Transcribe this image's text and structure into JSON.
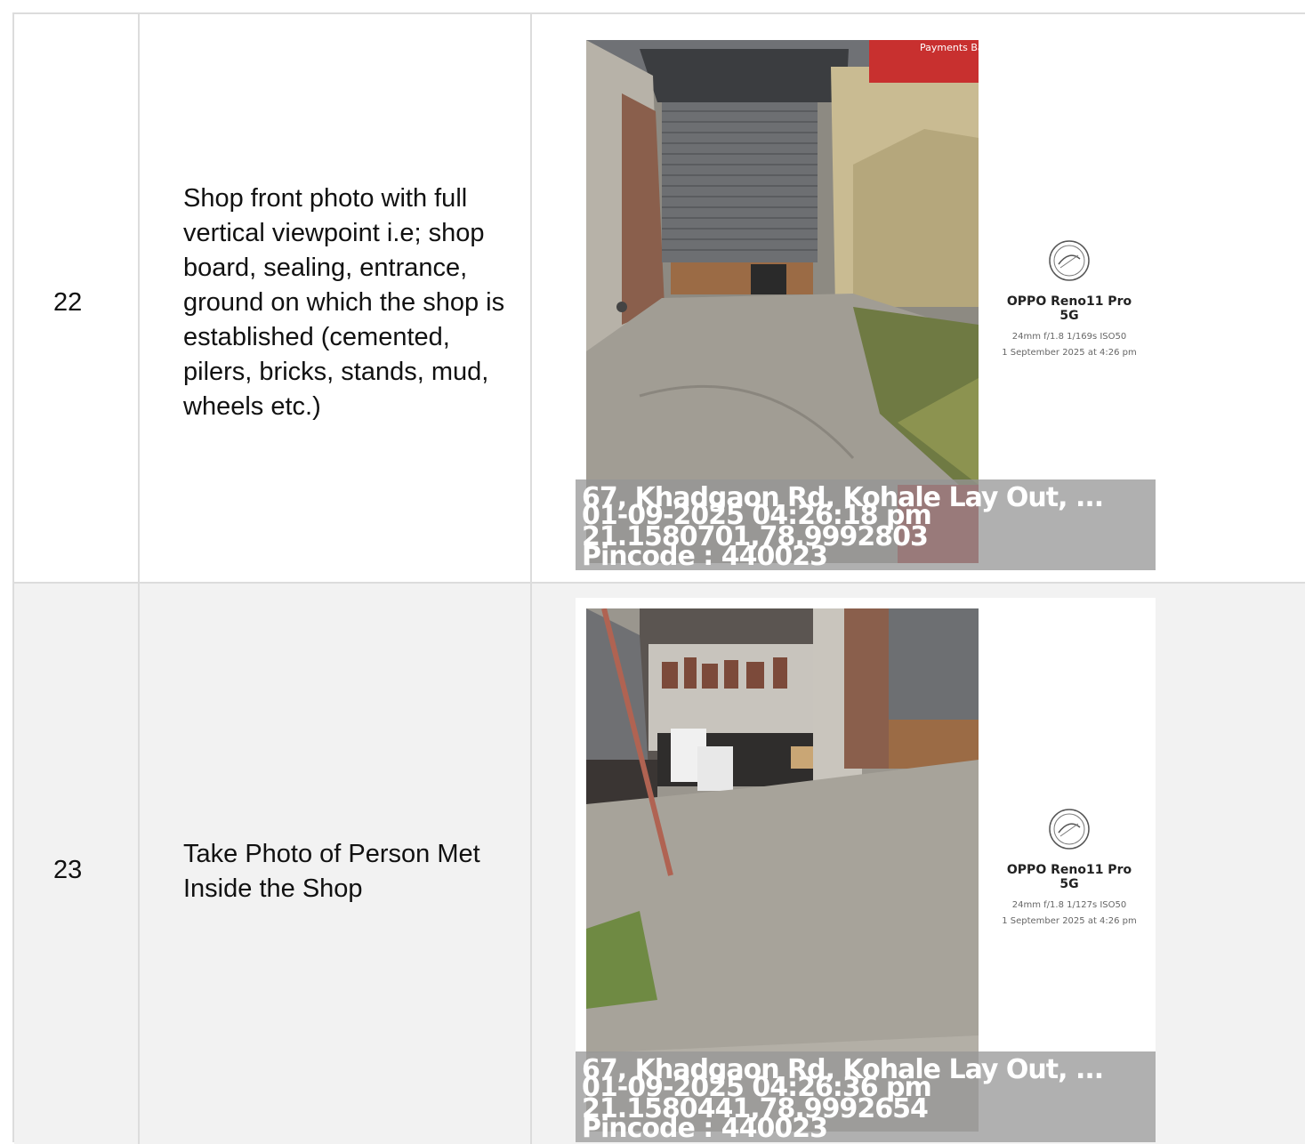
{
  "rows": [
    {
      "number": "22",
      "description": "Shop front photo with full vertical viewpoint i.e; shop board, sealing, entrance, ground on which the shop is established (cemented, pilers, bricks, stands, mud, wheels etc.)",
      "photo": {
        "camera_model": "OPPO Reno11 Pro 5G",
        "specs": "24mm  f/1.8  1/169s  ISO50",
        "captured": "1 September 2025 at 4:26 pm",
        "sign_text": "Payments Bank",
        "stamp": {
          "address": "67, Khadgaon Rd, Kohale Lay Out, ...",
          "datetime": "01-09-2025 04:26:18 pm",
          "coordinates": "21.1580701,78.9992803",
          "pincode": "Pincode : 440023"
        }
      }
    },
    {
      "number": "23",
      "description": "Take Photo of Person Met Inside the Shop",
      "photo": {
        "camera_model": "OPPO Reno11 Pro 5G",
        "specs": "24mm  f/1.8  1/127s  ISO50",
        "captured": "1 September 2025 at 4:26 pm",
        "stamp": {
          "address": "67, Khadgaon Rd, Kohale Lay Out, ...",
          "datetime": "01-09-2025 04:26:36 pm",
          "coordinates": "21.1580441,78.9992654",
          "pincode": "Pincode : 440023"
        }
      }
    }
  ]
}
